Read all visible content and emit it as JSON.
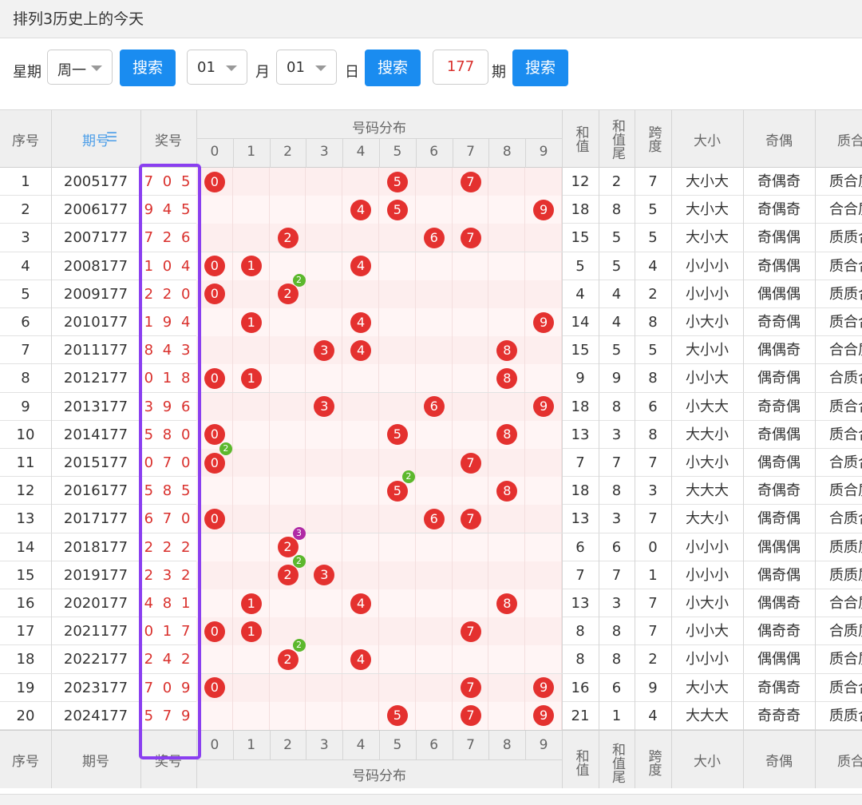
{
  "title": "排列3历史上的今天",
  "toolbar": {
    "weekday_label": "星期",
    "weekday_value": "周一",
    "search_label": "搜索",
    "month_value": "01",
    "month_label": "月",
    "day_value": "01",
    "day_label": "日",
    "issue_value": "177",
    "issue_label": "期"
  },
  "header": {
    "seq": "序号",
    "issue": "期号",
    "prize": "奖号",
    "dist": "号码分布",
    "digits": [
      "0",
      "1",
      "2",
      "3",
      "4",
      "5",
      "6",
      "7",
      "8",
      "9"
    ],
    "sum": "和值",
    "sum_tail": "和值尾",
    "span": "跨度",
    "size": "大小",
    "oddeven": "奇偶",
    "prime": "质合"
  },
  "rows": [
    {
      "seq": "1",
      "issue": "2005177",
      "prize": "7 0 5",
      "sum": "12",
      "tail": "2",
      "span": "7",
      "size": "大小大",
      "oe": "奇偶奇",
      "pc": "质合质"
    },
    {
      "seq": "2",
      "issue": "2006177",
      "prize": "9 4 5",
      "sum": "18",
      "tail": "8",
      "span": "5",
      "size": "大小大",
      "oe": "奇偶奇",
      "pc": "合合质"
    },
    {
      "seq": "3",
      "issue": "2007177",
      "prize": "7 2 6",
      "sum": "15",
      "tail": "5",
      "span": "5",
      "size": "大小大",
      "oe": "奇偶偶",
      "pc": "质质合"
    },
    {
      "seq": "4",
      "issue": "2008177",
      "prize": "1 0 4",
      "sum": "5",
      "tail": "5",
      "span": "4",
      "size": "小小小",
      "oe": "奇偶偶",
      "pc": "质合合"
    },
    {
      "seq": "5",
      "issue": "2009177",
      "prize": "2 2 0",
      "sum": "4",
      "tail": "4",
      "span": "2",
      "size": "小小小",
      "oe": "偶偶偶",
      "pc": "质质合"
    },
    {
      "seq": "6",
      "issue": "2010177",
      "prize": "1 9 4",
      "sum": "14",
      "tail": "4",
      "span": "8",
      "size": "小大小",
      "oe": "奇奇偶",
      "pc": "质合合"
    },
    {
      "seq": "7",
      "issue": "2011177",
      "prize": "8 4 3",
      "sum": "15",
      "tail": "5",
      "span": "5",
      "size": "大小小",
      "oe": "偶偶奇",
      "pc": "合合质"
    },
    {
      "seq": "8",
      "issue": "2012177",
      "prize": "0 1 8",
      "sum": "9",
      "tail": "9",
      "span": "8",
      "size": "小小大",
      "oe": "偶奇偶",
      "pc": "合质合"
    },
    {
      "seq": "9",
      "issue": "2013177",
      "prize": "3 9 6",
      "sum": "18",
      "tail": "8",
      "span": "6",
      "size": "小大大",
      "oe": "奇奇偶",
      "pc": "质合合"
    },
    {
      "seq": "10",
      "issue": "2014177",
      "prize": "5 8 0",
      "sum": "13",
      "tail": "3",
      "span": "8",
      "size": "大大小",
      "oe": "奇偶偶",
      "pc": "质合合"
    },
    {
      "seq": "11",
      "issue": "2015177",
      "prize": "0 7 0",
      "sum": "7",
      "tail": "7",
      "span": "7",
      "size": "小大小",
      "oe": "偶奇偶",
      "pc": "合质合"
    },
    {
      "seq": "12",
      "issue": "2016177",
      "prize": "5 8 5",
      "sum": "18",
      "tail": "8",
      "span": "3",
      "size": "大大大",
      "oe": "奇偶奇",
      "pc": "质合质"
    },
    {
      "seq": "13",
      "issue": "2017177",
      "prize": "6 7 0",
      "sum": "13",
      "tail": "3",
      "span": "7",
      "size": "大大小",
      "oe": "偶奇偶",
      "pc": "合质合"
    },
    {
      "seq": "14",
      "issue": "2018177",
      "prize": "2 2 2",
      "sum": "6",
      "tail": "6",
      "span": "0",
      "size": "小小小",
      "oe": "偶偶偶",
      "pc": "质质质"
    },
    {
      "seq": "15",
      "issue": "2019177",
      "prize": "2 3 2",
      "sum": "7",
      "tail": "7",
      "span": "1",
      "size": "小小小",
      "oe": "偶奇偶",
      "pc": "质质质"
    },
    {
      "seq": "16",
      "issue": "2020177",
      "prize": "4 8 1",
      "sum": "13",
      "tail": "3",
      "span": "7",
      "size": "小大小",
      "oe": "偶偶奇",
      "pc": "合合质"
    },
    {
      "seq": "17",
      "issue": "2021177",
      "prize": "0 1 7",
      "sum": "8",
      "tail": "8",
      "span": "7",
      "size": "小小大",
      "oe": "偶奇奇",
      "pc": "合质质"
    },
    {
      "seq": "18",
      "issue": "2022177",
      "prize": "2 4 2",
      "sum": "8",
      "tail": "8",
      "span": "2",
      "size": "小小小",
      "oe": "偶偶偶",
      "pc": "质合质"
    },
    {
      "seq": "19",
      "issue": "2023177",
      "prize": "7 0 9",
      "sum": "16",
      "tail": "6",
      "span": "9",
      "size": "大小大",
      "oe": "奇偶奇",
      "pc": "质合合"
    },
    {
      "seq": "20",
      "issue": "2024177",
      "prize": "5 7 9",
      "sum": "21",
      "tail": "1",
      "span": "4",
      "size": "大大大",
      "oe": "奇奇奇",
      "pc": "质质合"
    }
  ],
  "colors": {
    "ball": "#e4312f",
    "badge2": "#5cb82d",
    "badge3": "#b02aa6",
    "accent": "#1a8cf0",
    "highlight": "#8a3ff0"
  }
}
